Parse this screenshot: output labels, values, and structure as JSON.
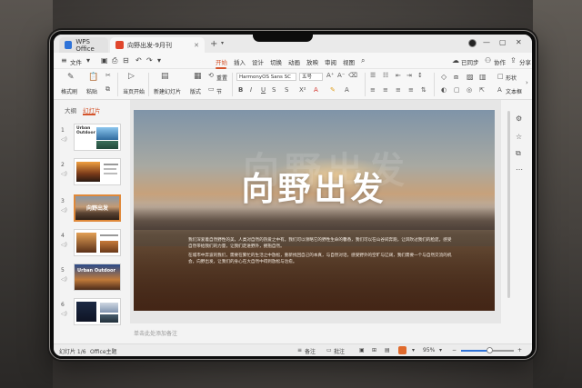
{
  "tabs": [
    {
      "label": "WPS Office",
      "icon": "wps-logo-icon",
      "color": "#2f73d8"
    },
    {
      "label": "向野出发-9月刊",
      "icon": "presentation-file-icon",
      "color": "#e0462c"
    }
  ],
  "menu": {
    "file_label": "文件",
    "items": [
      "开始",
      "插入",
      "设计",
      "切换",
      "动画",
      "放映",
      "审阅",
      "视图"
    ],
    "active": "开始",
    "right": [
      "已同步",
      "协作",
      "分享"
    ]
  },
  "ribbon": {
    "format_painter": "格式刷",
    "paste": "粘贴",
    "play_from_current": "当页开始",
    "new_slide": "新建幻灯片",
    "layout": "版式",
    "section": "节",
    "reset": "重置",
    "font_name": "HarmonyOS Sans SC",
    "font_size": "五号",
    "shape": "形状",
    "textbox": "文本框"
  },
  "left_panel": {
    "tabs": [
      "大纲",
      "幻灯片"
    ],
    "active_tab": "幻灯片",
    "thumbnails": [
      {
        "num": "1",
        "title": "Urban Outdoor"
      },
      {
        "num": "2",
        "title": ""
      },
      {
        "num": "3",
        "title": "向野出发"
      },
      {
        "num": "4",
        "title": ""
      },
      {
        "num": "5",
        "title": "Urban Outdoor"
      },
      {
        "num": "6",
        "title": ""
      }
    ],
    "selected": 3
  },
  "slide": {
    "ghost_title": "向野出发",
    "title": "向野出发",
    "body": [
      "我们深爱着自然野性的美，人类对自然的热爱之中有。我们可以领略它的野性生命的馨香，我们可以在山谷间奔跑，让风吹过我们的脸庞，感受自然带给我们的力量，让我们走进野外，拥抱自然。",
      "在城市中奔波的我们，需要在繁忙的生活之中放松，重新找回自己的本真，与自然对话，感受野外的空旷与辽阔，我们需要一个与自然交流的机会，向野出发，让我们的身心在大自然中得到放松与治愈。"
    ]
  },
  "notes_placeholder": "单击此处添加备注",
  "status": {
    "slide_counter": "幻灯片 1/6",
    "theme": "Office主题",
    "notes_btn": "备注",
    "comments_btn": "批注",
    "zoom": "95%",
    "zoom_fraction": 0.55
  },
  "colors": {
    "accent": "#d4542c",
    "selected_thumb": "#e0893a",
    "zoom_fill": "#2f73d8"
  }
}
